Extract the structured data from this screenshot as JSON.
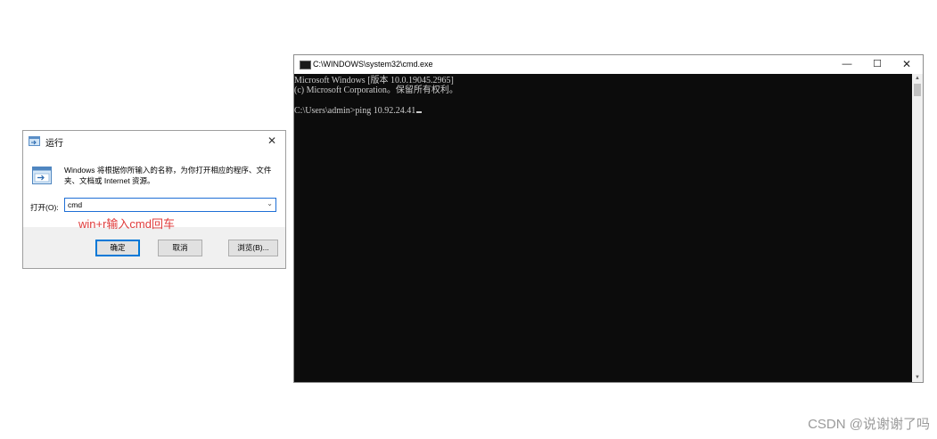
{
  "run_dialog": {
    "title": "运行",
    "description": "Windows 将根据你所输入的名称，为你打开相应的程序、文件夹、文档或 Internet 资源。",
    "open_label": "打开(O):",
    "input_value": "cmd",
    "annotation": "win+r输入cmd回车",
    "ok_label": "确定",
    "cancel_label": "取消",
    "browse_label": "浏览(B)...",
    "close_glyph": "✕",
    "dropdown_glyph": "⌄",
    "icon": "run-program-icon",
    "annotation_color": "#e03c3c"
  },
  "cmd_window": {
    "title": "C:\\WINDOWS\\system32\\cmd.exe",
    "minimize_glyph": "—",
    "maximize_glyph": "☐",
    "close_glyph": "✕",
    "lines": [
      "Microsoft Windows [版本 10.0.19045.2965]",
      "(c) Microsoft Corporation。保留所有权利。"
    ],
    "prompt_line": "C:\\Users\\admin>ping 10.92.24.41",
    "scroll_up_glyph": "▲",
    "scroll_down_glyph": "▼",
    "background_color": "#0c0c0c",
    "text_color": "#cccccc"
  },
  "watermark": "CSDN @说谢谢了吗"
}
